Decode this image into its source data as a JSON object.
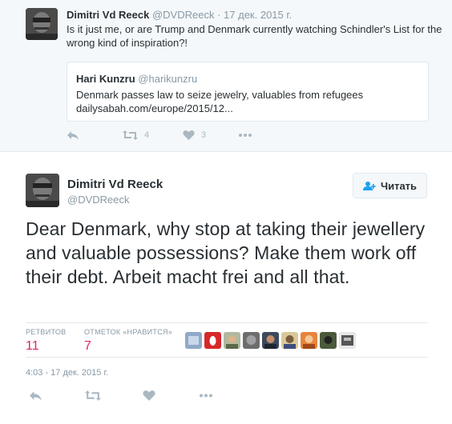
{
  "parent_tweet": {
    "author_name": "Dimitri Vd Reeck",
    "author_handle": "@DVDReeck",
    "separator": "·",
    "date": "17 дек. 2015 г.",
    "text": "Is it just me, or are Trump and Denmark currently watching Schindler's List for the wrong kind of inspiration?!",
    "quoted": {
      "author_name": "Hari Kunzru",
      "author_handle": "@harikunzru",
      "text_line1": "Denmark passes law to seize jewelry, valuables from refugees",
      "text_line2": "dailysabah.com/europe/2015/12..."
    },
    "actions": {
      "reply_icon": "reply-icon",
      "retweet_icon": "retweet-icon",
      "retweet_count": "4",
      "like_icon": "heart-icon",
      "like_count": "3",
      "more_icon": "more-icon"
    }
  },
  "main_tweet": {
    "author_name": "Dimitri Vd Reeck",
    "author_handle": "@DVDReeck",
    "follow_label": "Читать",
    "text": "Dear Denmark, why stop at taking their jewellery and valuable possessions? Make them work off their debt. Arbeit macht frei and all that.",
    "stats": {
      "retweets_label": "РЕТВИТОВ",
      "retweets_count": "11",
      "likes_label": "ОТМЕТОК «НРАВИТСЯ»",
      "likes_count": "7"
    },
    "timestamp": "4:03 - 17 дек. 2015 г."
  },
  "colors": {
    "background_top": "#f5f8fa",
    "text": "#292f33",
    "muted": "#8899a6",
    "stat_number": "#e0245e",
    "border": "#e1e8ed"
  }
}
